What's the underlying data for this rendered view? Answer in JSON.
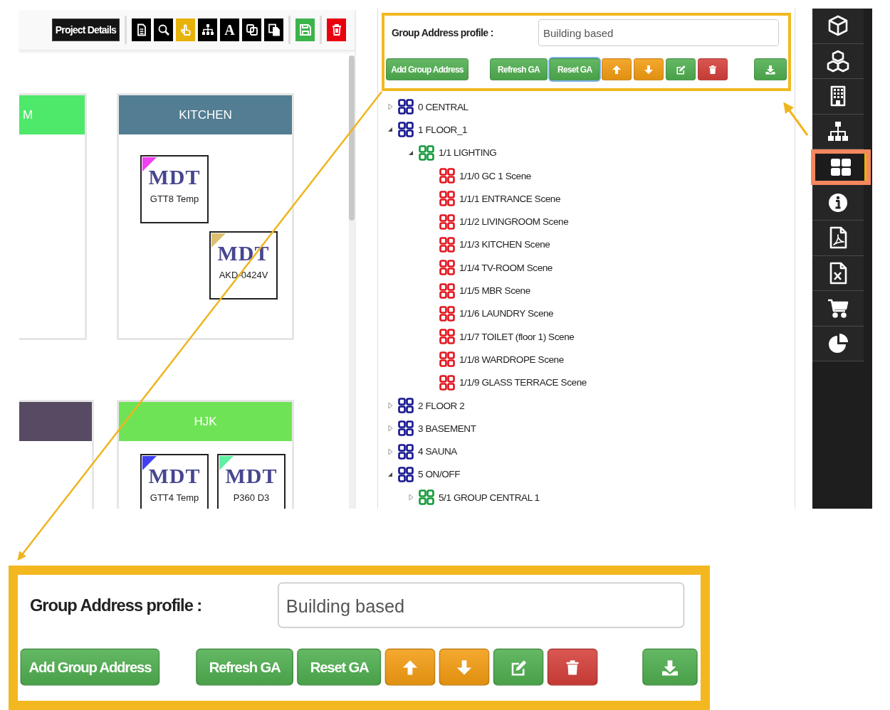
{
  "toolbar": {
    "project_button": "Project Details",
    "tools": [
      {
        "kind": "document",
        "selected": false
      },
      {
        "kind": "search",
        "selected": false
      },
      {
        "kind": "hand",
        "selected": true
      },
      {
        "kind": "sitemap",
        "selected": false
      },
      {
        "kind": "text",
        "label": "A",
        "selected": false
      },
      {
        "kind": "copy",
        "selected": false
      },
      {
        "kind": "paste",
        "selected": false
      }
    ]
  },
  "rooms": [
    {
      "name": "M",
      "color": "#4ee86a"
    },
    {
      "name": "KITCHEN",
      "color": "#537d92",
      "devices": [
        {
          "logo": "MDT",
          "name": "GTT8 Temp",
          "color": "#f040f0"
        },
        {
          "logo": "MDT",
          "name": "AKD-0424V",
          "color": "#dcc070"
        }
      ]
    },
    {
      "color": "#574a63"
    },
    {
      "name": "HJK",
      "color": "#6fe356",
      "devices": [
        {
          "logo": "MDT",
          "name": "GTT4 Temp",
          "color": "#4040f0"
        },
        {
          "logo": "MDT",
          "name": "P360 D3",
          "color": "#60f0a0"
        }
      ]
    }
  ],
  "group_address": {
    "label": "Group Address profile :",
    "profile_value": "Building based",
    "buttons": [
      {
        "kind": "text",
        "label": "Add Group Address",
        "color": "#4fae4f",
        "focused": false
      },
      {
        "kind": "text",
        "label": "Refresh GA",
        "color": "#4fae4f",
        "focused": false
      },
      {
        "kind": "text",
        "label": "Reset GA",
        "color": "#4fae4f",
        "focused": true
      },
      {
        "kind": "up",
        "color": "#f39c12",
        "focused": false
      },
      {
        "kind": "down",
        "color": "#f39c12",
        "focused": false
      },
      {
        "kind": "edit",
        "color": "#4fae4f",
        "focused": false
      },
      {
        "kind": "delete",
        "color": "#d43f3a",
        "focused": false
      },
      {
        "kind": "download",
        "color": "#4fae4f",
        "focused": false
      }
    ]
  },
  "tree": [
    {
      "label": "0 CENTRAL",
      "expanded": false
    },
    {
      "label": "1 FLOOR_1",
      "expanded": true,
      "children": [
        {
          "label": "1/1 LIGHTING",
          "expanded": true,
          "children": [
            {
              "label": "1/1/0 GC 1 Scene"
            },
            {
              "label": "1/1/1 ENTRANCE Scene"
            },
            {
              "label": "1/1/2 LIVINGROOM Scene"
            },
            {
              "label": "1/1/3 KITCHEN Scene"
            },
            {
              "label": "1/1/4 TV-ROOM Scene"
            },
            {
              "label": "1/1/5 MBR Scene"
            },
            {
              "label": "1/1/6 LAUNDRY Scene"
            },
            {
              "label": "1/1/7 TOILET (floor 1) Scene"
            },
            {
              "label": "1/1/8 WARDROPE Scene"
            },
            {
              "label": "1/1/9 GLASS TERRACE Scene"
            }
          ]
        }
      ]
    },
    {
      "label": "2 FLOOR 2",
      "expanded": false
    },
    {
      "label": "3 BASEMENT",
      "expanded": false
    },
    {
      "label": "4 SAUNA",
      "expanded": false
    },
    {
      "label": "5 ON/OFF",
      "expanded": true,
      "children": [
        {
          "label": "5/1 GROUP CENTRAL 1",
          "expanded": false
        }
      ]
    }
  ],
  "sidebar": {
    "items": [
      {
        "kind": "cube",
        "selected": false
      },
      {
        "kind": "cubes",
        "selected": false
      },
      {
        "kind": "building",
        "selected": false
      },
      {
        "kind": "sitemap",
        "selected": false
      },
      {
        "kind": "grid",
        "selected": true
      },
      {
        "kind": "info",
        "selected": false
      },
      {
        "kind": "pdf",
        "selected": false
      },
      {
        "kind": "excel",
        "selected": false
      },
      {
        "kind": "cart",
        "selected": false
      },
      {
        "kind": "pie",
        "selected": false
      }
    ]
  },
  "zoom_inset": {
    "label": "Group Address profile :",
    "profile_value": "Building based",
    "buttons": [
      {
        "kind": "text",
        "label": "Add Group Address",
        "color": "#4fae4f"
      },
      {
        "kind": "text",
        "label": "Refresh GA",
        "color": "#4fae4f"
      },
      {
        "kind": "text",
        "label": "Reset GA",
        "color": "#4fae4f"
      },
      {
        "kind": "up",
        "color": "#f39c12"
      },
      {
        "kind": "down",
        "color": "#f39c12"
      },
      {
        "kind": "edit",
        "color": "#4fae4f"
      },
      {
        "kind": "delete",
        "color": "#d43f3a"
      },
      {
        "kind": "download",
        "color": "#4fae4f"
      }
    ]
  }
}
